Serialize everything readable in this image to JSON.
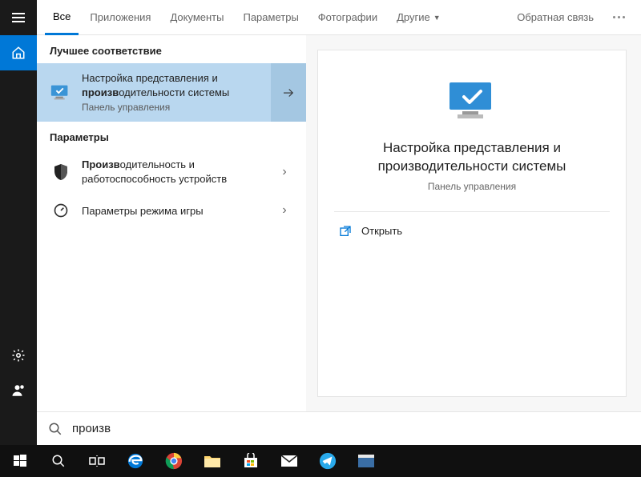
{
  "tabs": {
    "all": "Все",
    "apps": "Приложения",
    "docs": "Документы",
    "settings": "Параметры",
    "photos": "Фотографии",
    "more": "Другие",
    "feedback": "Обратная связь"
  },
  "sections": {
    "best_match": "Лучшее соответствие",
    "settings": "Параметры"
  },
  "results": {
    "item0": {
      "prefix": "Настройка представления и ",
      "bold": "произв",
      "suffix": "одительности системы",
      "sub": "Панель управления"
    },
    "item1": {
      "bold": "Произв",
      "suffix": "одительность и работоспособность устройств"
    },
    "item2": {
      "label": "Параметры режима игры"
    }
  },
  "preview": {
    "title": "Настройка представления и производительности системы",
    "meta": "Панель управления",
    "open": "Открыть"
  },
  "search": {
    "value": "произв"
  }
}
